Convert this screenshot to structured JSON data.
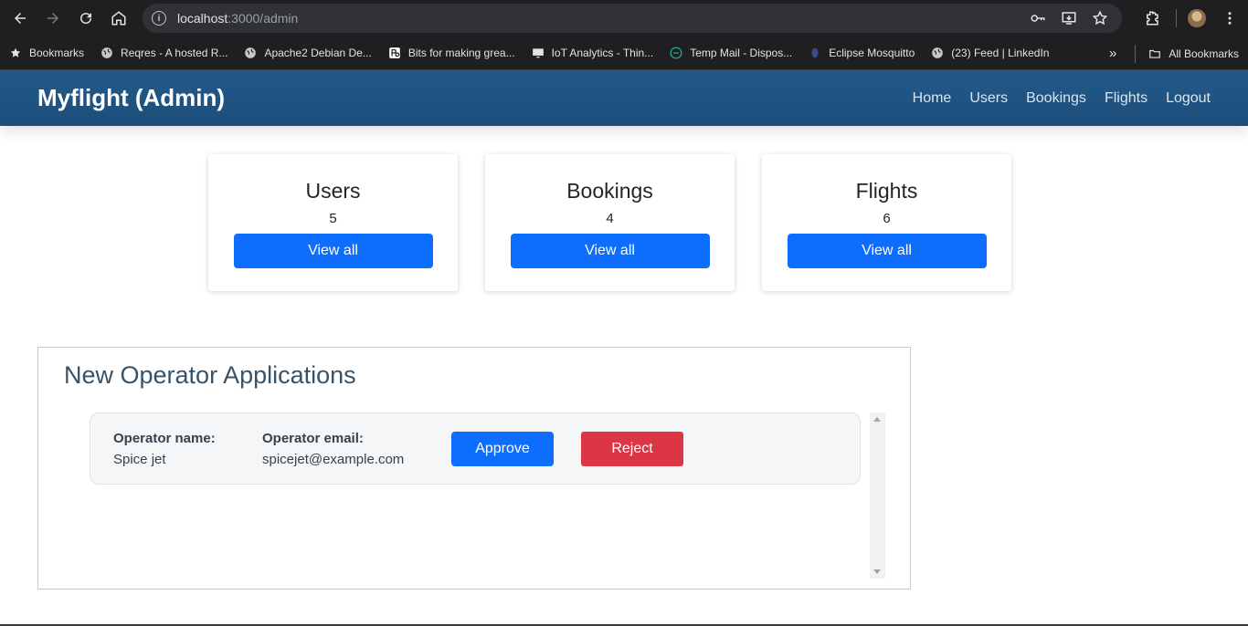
{
  "browser": {
    "url_host": "localhost",
    "url_path": ":3000/admin",
    "bookmarks": [
      {
        "label": "Bookmarks",
        "icon": "star-icon"
      },
      {
        "label": "Reqres - A hosted R...",
        "icon": "globe-icon"
      },
      {
        "label": "Apache2 Debian De...",
        "icon": "globe-icon"
      },
      {
        "label": "Bits for making grea...",
        "icon": "bits-icon"
      },
      {
        "label": "IoT Analytics - Thin...",
        "icon": "iot-icon"
      },
      {
        "label": "Temp Mail - Dispos...",
        "icon": "tempmail-icon"
      },
      {
        "label": "Eclipse Mosquitto",
        "icon": "mosquitto-icon"
      },
      {
        "label": "(23) Feed | LinkedIn",
        "icon": "globe-icon"
      }
    ],
    "all_bookmarks": "All Bookmarks"
  },
  "navbar": {
    "brand": "Myflight (Admin)",
    "links": [
      "Home",
      "Users",
      "Bookings",
      "Flights",
      "Logout"
    ]
  },
  "stats": [
    {
      "title": "Users",
      "count": "5",
      "button": "View all"
    },
    {
      "title": "Bookings",
      "count": "4",
      "button": "View all"
    },
    {
      "title": "Flights",
      "count": "6",
      "button": "View all"
    }
  ],
  "applications": {
    "heading": "New Operator Applications",
    "items": [
      {
        "name_label": "Operator name:",
        "name": "Spice jet",
        "email_label": "Operator email:",
        "email": "spicejet@example.com",
        "approve": "Approve",
        "reject": "Reject"
      }
    ]
  },
  "colors": {
    "navbar": "#1d4e7a",
    "primary": "#0d6efd",
    "danger": "#dc3545"
  }
}
